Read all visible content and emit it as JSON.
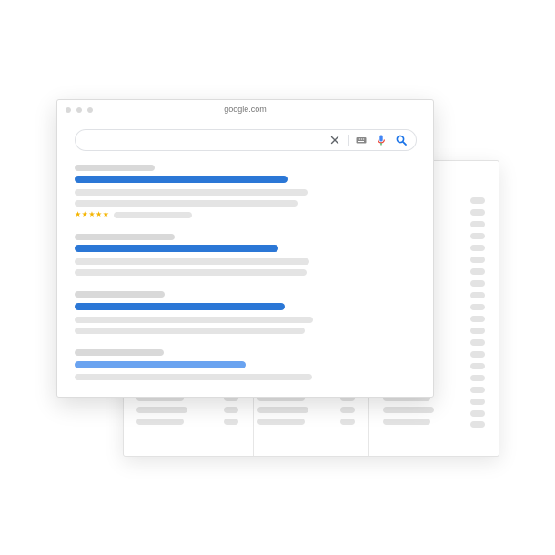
{
  "browser": {
    "url": "google.com"
  },
  "search": {
    "query": "",
    "placeholder": ""
  },
  "icons": {
    "clear": "close-icon",
    "keyboard": "keyboard-icon",
    "voice": "microphone-icon",
    "search": "search-icon"
  },
  "results": [
    {
      "rating": "★★★★★"
    }
  ],
  "colors": {
    "accent_blue": "#2b77d6",
    "light_blue": "#6aa3f0",
    "star_yellow": "#f4b400",
    "mic_red": "#ea4335"
  }
}
